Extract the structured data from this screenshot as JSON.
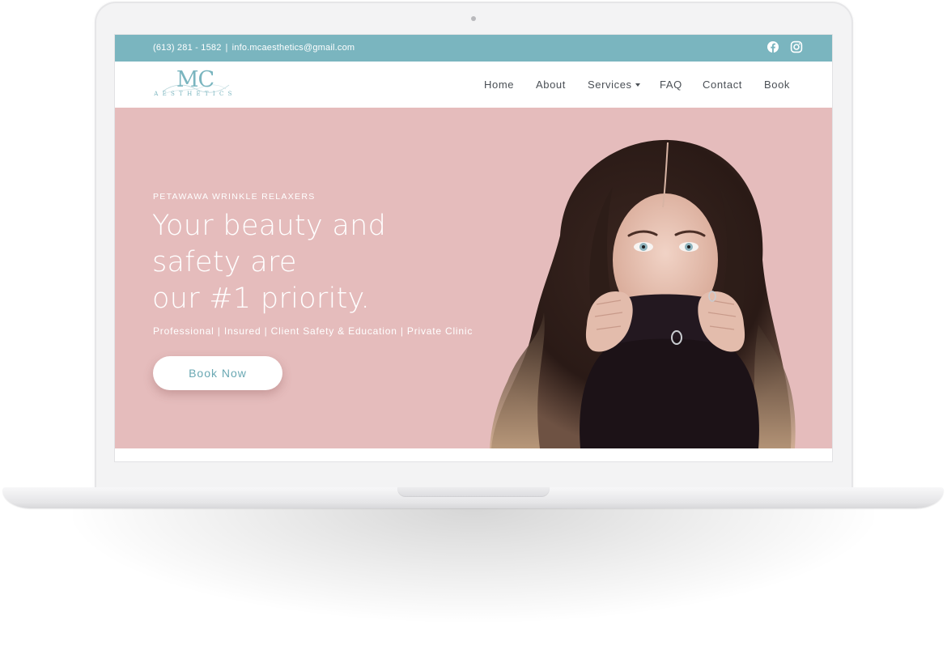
{
  "topbar": {
    "phone": "(613) 281 - 1582",
    "separator": "|",
    "email": "info.mcaesthetics@gmail.com",
    "social_icons": [
      "facebook-icon",
      "instagram-icon"
    ]
  },
  "logo": {
    "initials": "MC",
    "subtitle": "AESTHETICS"
  },
  "nav": {
    "items": [
      {
        "label": "Home"
      },
      {
        "label": "About"
      },
      {
        "label": "Services",
        "has_dropdown": true
      },
      {
        "label": "FAQ"
      },
      {
        "label": "Contact"
      },
      {
        "label": "Book"
      }
    ]
  },
  "hero": {
    "eyebrow": "PETAWAWA WRINKLE RELAXERS",
    "headline_lines": [
      "Your beauty and",
      "safety are",
      "our #1 priority."
    ],
    "subline": "Professional | Insured | Client Safety & Education | Private Clinic",
    "cta_label": "Book Now"
  },
  "colors": {
    "accent_teal": "#7ab5bf",
    "hero_pink": "#e5bcbc",
    "nav_text": "#4a4f55"
  }
}
